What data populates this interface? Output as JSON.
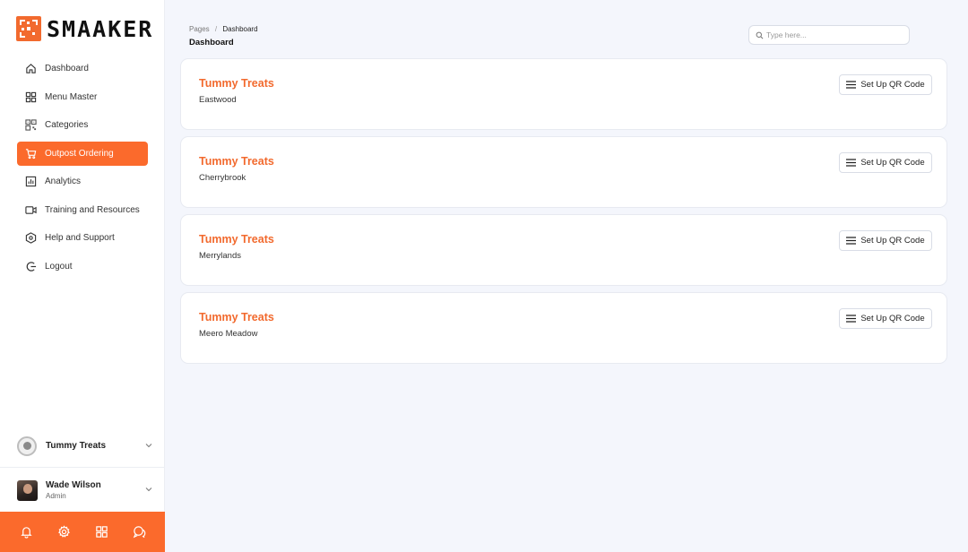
{
  "brand": {
    "name": "SMAAKER",
    "accent": "#fb6a2c"
  },
  "sidebar": {
    "items": [
      {
        "label": "Dashboard",
        "icon": "home-icon",
        "active": false
      },
      {
        "label": "Menu Master",
        "icon": "grid-icon",
        "active": false
      },
      {
        "label": "Categories",
        "icon": "qr-icon",
        "active": false
      },
      {
        "label": "Outpost Ordering",
        "icon": "cart-icon",
        "active": true
      },
      {
        "label": "Analytics",
        "icon": "chart-icon",
        "active": false
      },
      {
        "label": "Training and Resources",
        "icon": "video-icon",
        "active": false
      },
      {
        "label": "Help and Support",
        "icon": "help-icon",
        "active": false
      },
      {
        "label": "Logout",
        "icon": "logout-icon",
        "active": false
      }
    ],
    "store": {
      "name": "Tummy Treats"
    },
    "user": {
      "name": "Wade Wilson",
      "role": "Admin"
    },
    "bottom_icons": [
      "bell-icon",
      "gear-icon",
      "apps-icon",
      "chat-icon"
    ]
  },
  "header": {
    "breadcrumb": {
      "parent": "Pages",
      "separator": "/",
      "current": "Dashboard"
    },
    "title": "Dashboard",
    "search": {
      "placeholder": "Type here...",
      "value": ""
    }
  },
  "outlets": [
    {
      "name": "Tummy Treats",
      "location": "Eastwood",
      "button_label": "Set Up QR Code"
    },
    {
      "name": "Tummy Treats",
      "location": "Cherrybrook",
      "button_label": "Set Up QR Code"
    },
    {
      "name": "Tummy Treats",
      "location": "Merrylands",
      "button_label": "Set Up QR Code"
    },
    {
      "name": "Tummy Treats",
      "location": "Meero Meadow",
      "button_label": "Set Up QR Code"
    }
  ]
}
